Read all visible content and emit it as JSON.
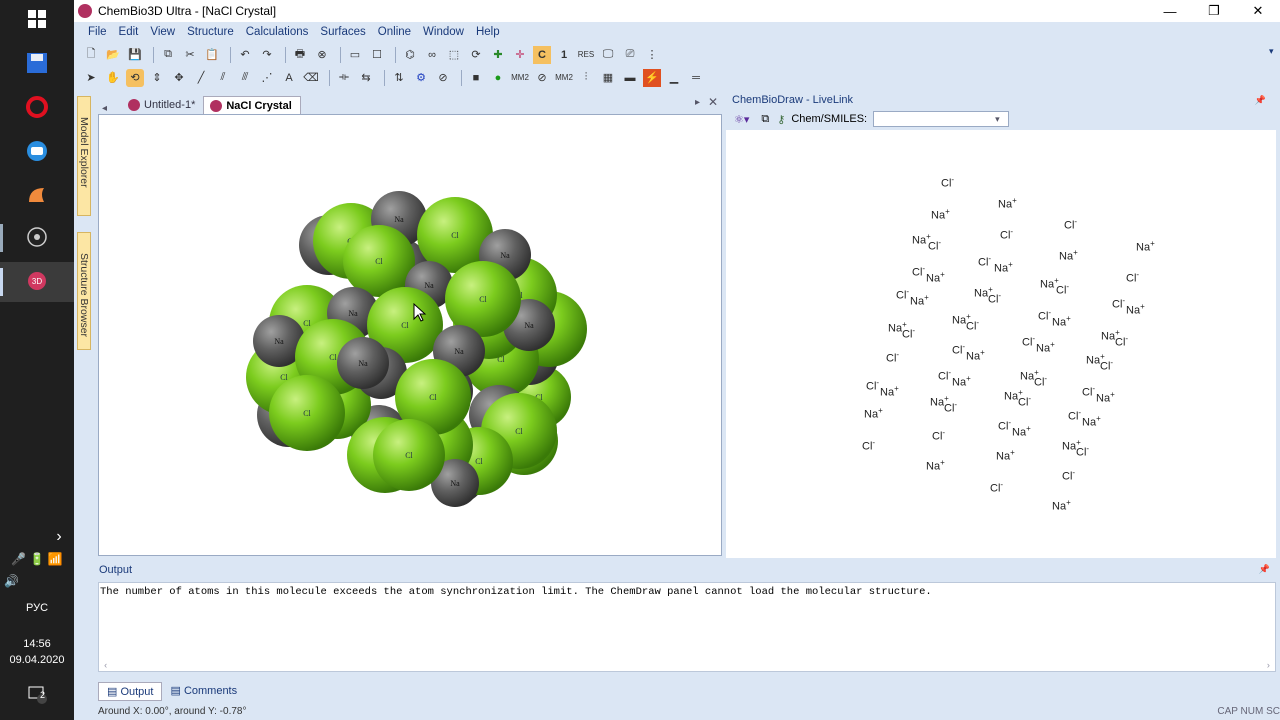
{
  "window": {
    "title": "ChemBio3D Ultra - [NaCl Crystal]"
  },
  "menu": [
    "File",
    "Edit",
    "View",
    "Structure",
    "Calculations",
    "Surfaces",
    "Online",
    "Window",
    "Help"
  ],
  "side_tabs": [
    "Model Explorer",
    "Structure Browser"
  ],
  "doc_tabs": [
    "Untitled-1*",
    "NaCl Crystal"
  ],
  "livelink": {
    "title": "ChemBioDraw - LiveLink",
    "smiles_label": "Chem/SMILES:"
  },
  "output": {
    "title": "Output",
    "message": "The number of atoms in this molecule exceeds the atom synchronization limit. The ChemDraw panel cannot load the molecular structure."
  },
  "bottom_tabs": [
    "Output",
    "Comments"
  ],
  "status": {
    "text": "Around X: 0.00°, around Y: -0.78°",
    "indicators": "CAP NUM SC"
  },
  "taskbar": {
    "lang": "РУС",
    "time": "14:56",
    "date": "09.04.2020",
    "notif_count": "2"
  },
  "atom_labels": {
    "cl": "Cl",
    "na": "Na"
  },
  "ions": {
    "cl": "Cl",
    "na": "Na",
    "minus": "-",
    "plus": "+"
  },
  "colors": {
    "chlorine": "#7ccc1e",
    "sodium": "#6a6a6a",
    "accent": "#1a3a7a"
  }
}
